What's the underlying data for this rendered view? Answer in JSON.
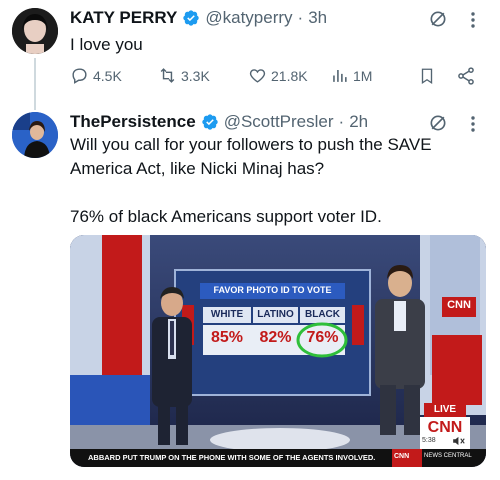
{
  "tweet1": {
    "name": "KATY PERRY",
    "handle": "@katyperry",
    "dot": "·",
    "time": "3h",
    "text": "I love you",
    "replies": "4.5K",
    "retweets": "3.3K",
    "likes": "21.8K",
    "views": "1M"
  },
  "tweet2": {
    "name": "ThePersistence",
    "handle": "@ScottPresler",
    "dot": "·",
    "time": "2h",
    "text_line1": "Will you call for your followers to push the SAVE",
    "text_line2": "America Act, like Nicki Minaj has?",
    "text_line3": "76% of black Americans support voter ID.",
    "media": {
      "graphic_title": "FAVOR PHOTO ID TO VOTE",
      "columns": [
        "WHITE",
        "LATINO",
        "BLACK"
      ],
      "values": [
        "85%",
        "82%",
        "76%"
      ],
      "live_label": "LIVE",
      "network": "CNN",
      "clock": "5:38",
      "ticker": "ABBARD PUT TRUMP ON THE PHONE WITH SOME OF THE AGENTS INVOLVED.",
      "ticker_right": "NEWS CENTRAL"
    }
  },
  "colors": {
    "accent": "#1d9bf0",
    "grey": "#536471",
    "verified": "#1d9bf0"
  }
}
